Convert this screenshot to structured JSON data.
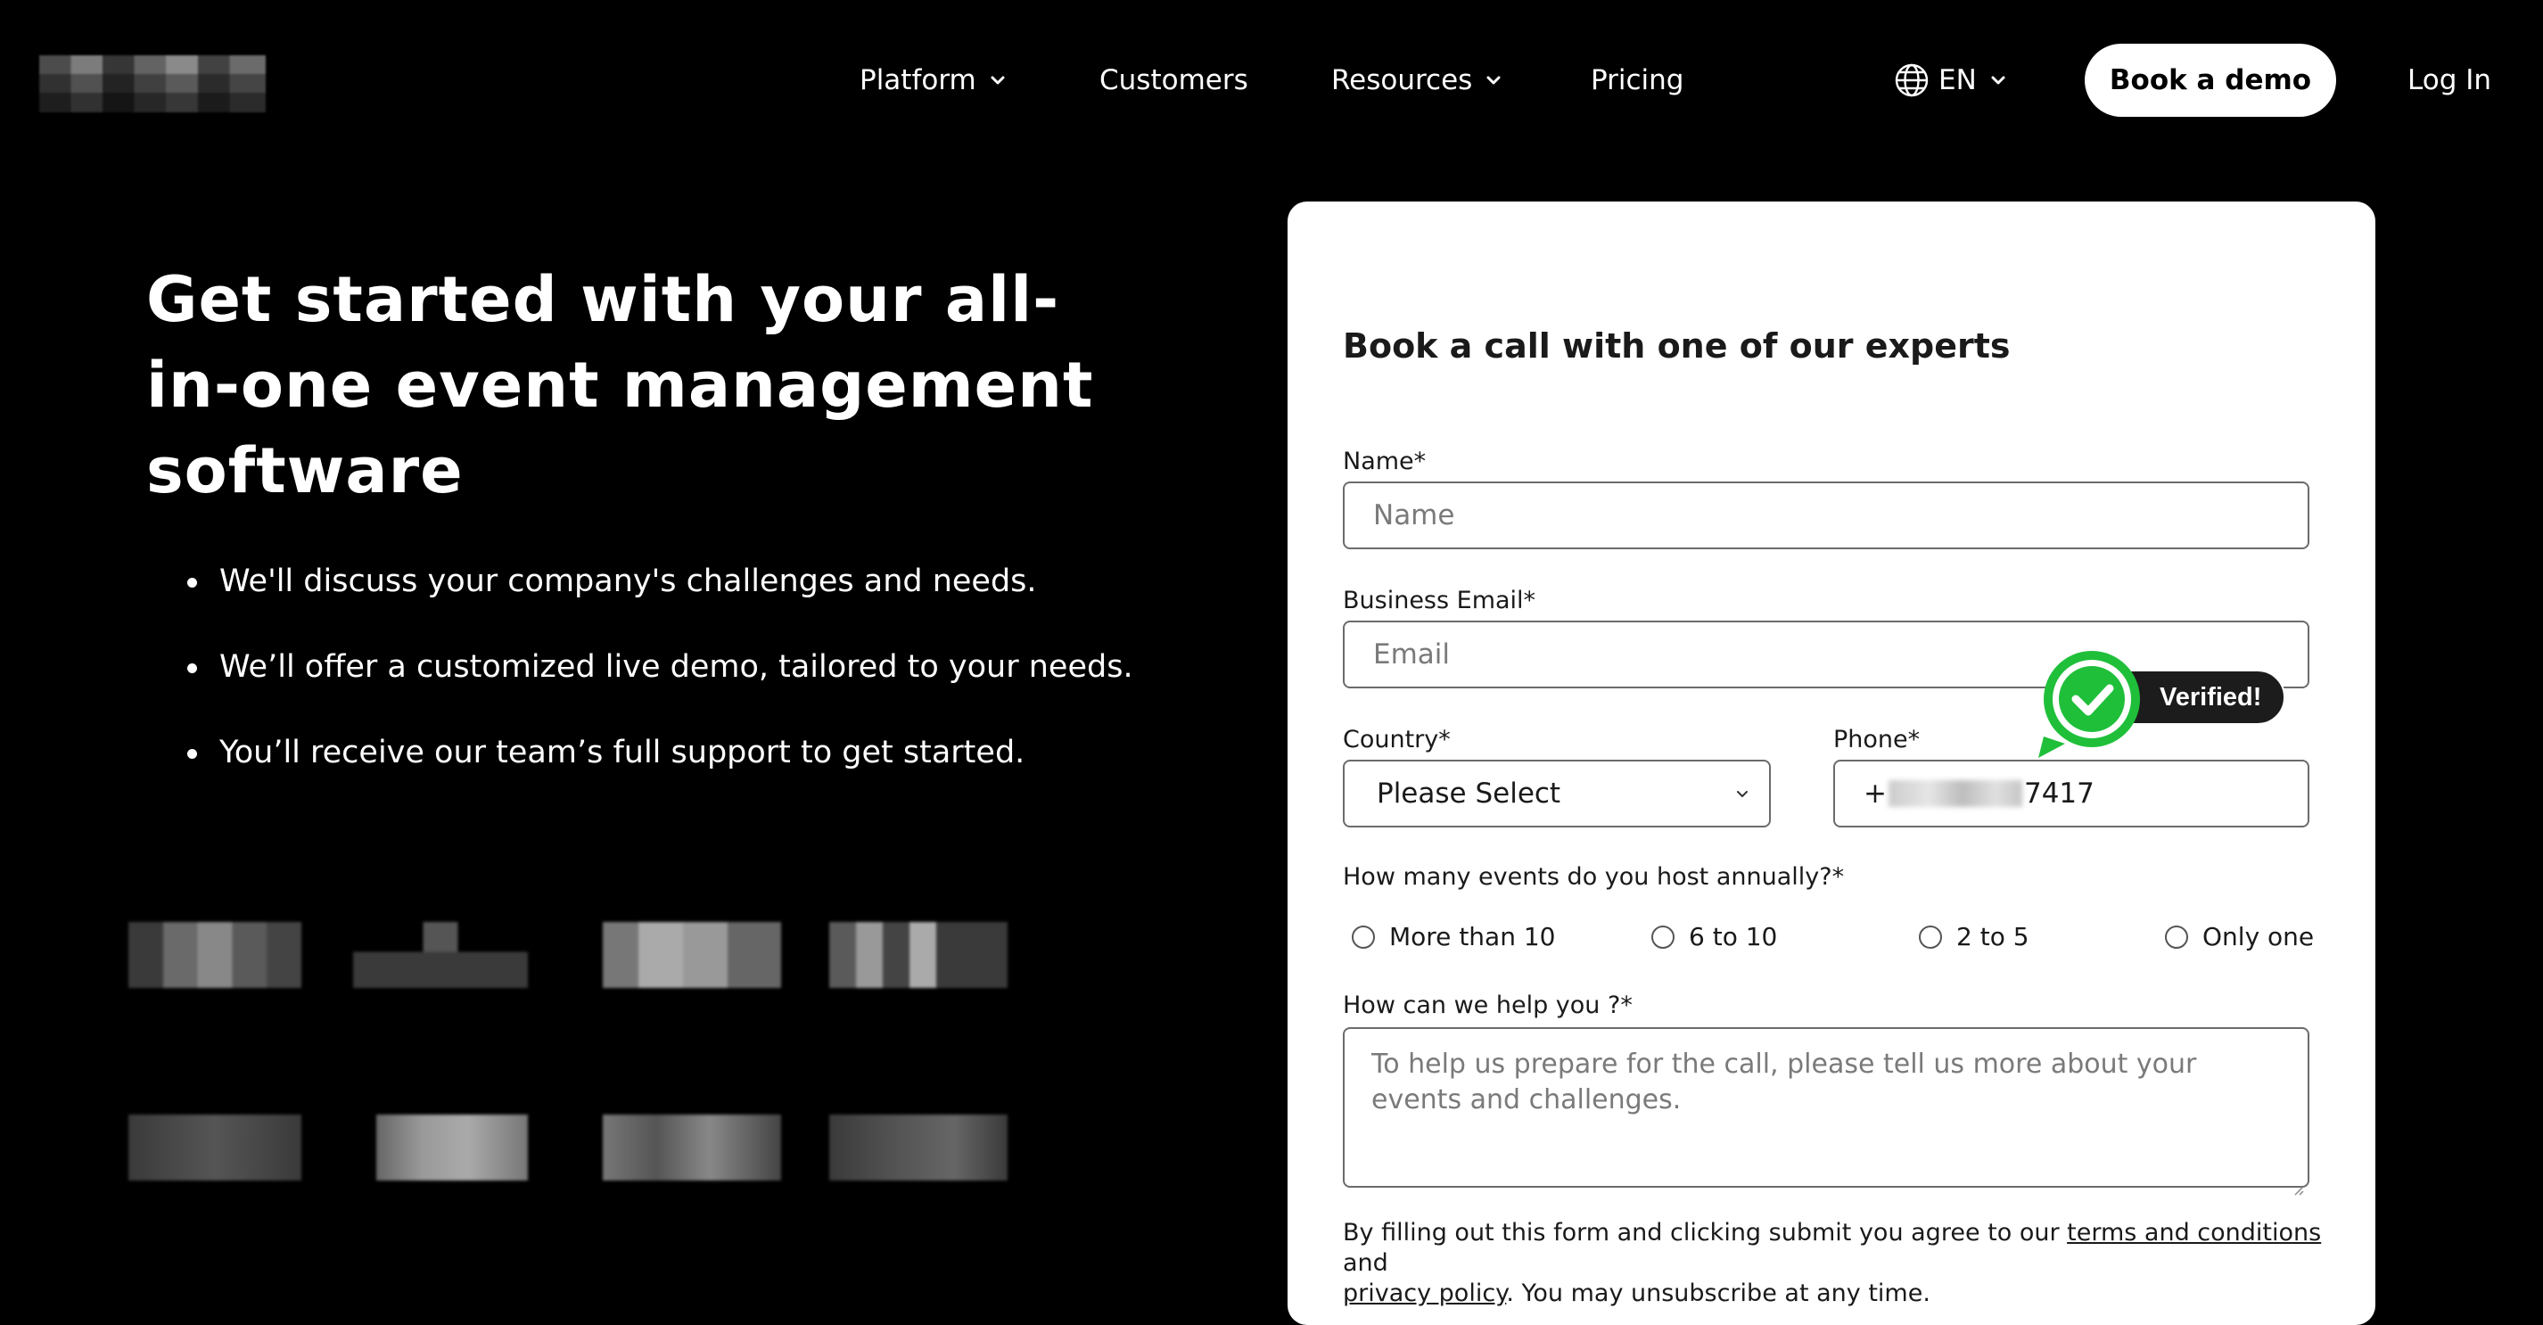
{
  "nav": {
    "platform": "Platform",
    "customers": "Customers",
    "resources": "Resources",
    "pricing": "Pricing",
    "language": "EN",
    "book_demo": "Book a demo",
    "login": "Log In"
  },
  "hero": {
    "title": "Get started with your all-in-one event management software",
    "bullets": [
      "We'll discuss your company's challenges and needs.",
      "We’ll offer a customized live demo, tailored to your needs.",
      "You’ll receive our team’s full support to get started."
    ]
  },
  "form": {
    "title": "Book a call with one of our experts",
    "name_label": "Name*",
    "name_placeholder": "Name",
    "email_label": "Business Email*",
    "email_placeholder": "Email",
    "country_label": "Country*",
    "country_value": "Please Select",
    "phone_label": "Phone*",
    "phone_prefix": "+",
    "phone_suffix": "7417",
    "events_label": "How many events do you host annually?*",
    "events_options": [
      "More than 10",
      "6 to 10",
      "2 to 5",
      "Only one"
    ],
    "help_label": "How can we help you ?*",
    "help_placeholder": "To help us prepare for the call, please tell us more about your events and challenges.",
    "legal_prefix": "By filling out this form and clicking submit you agree to our ",
    "terms_link": "terms and conditions",
    "legal_and": " and",
    "privacy_link": "privacy policy",
    "legal_suffix": ". You may unsubscribe at any time."
  },
  "badge": {
    "verified": "Verified!"
  },
  "colors": {
    "background": "#000000",
    "card": "#ffffff",
    "badge_green": "#1fbf3a",
    "badge_dark": "#1c1c1c"
  }
}
